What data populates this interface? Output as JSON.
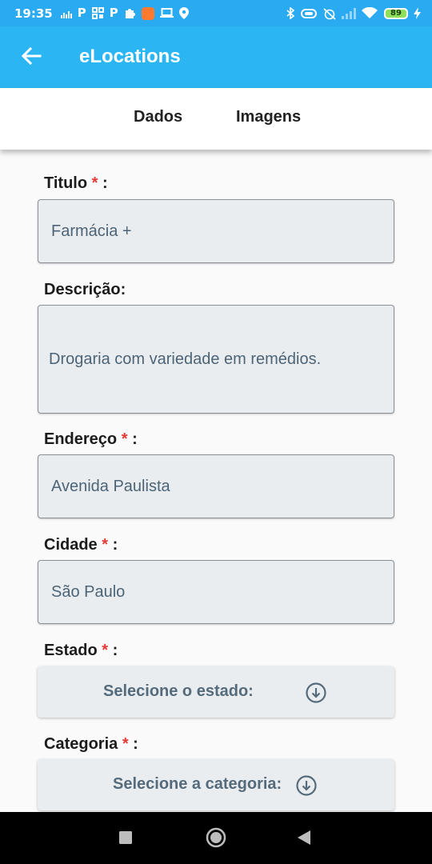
{
  "status_bar": {
    "time": "19:35",
    "battery": "89",
    "left_icons": [
      "equalizer-icon",
      "p-icon",
      "grid-icon",
      "p-icon",
      "puzzle-icon",
      "orange-app-icon",
      "laptop-icon",
      "location-pin-icon"
    ],
    "right_icons": [
      "bluetooth-icon",
      "vibrate-icon",
      "alarm-off-icon",
      "signal-icon",
      "wifi-icon",
      "battery-icon",
      "charging-icon"
    ]
  },
  "app_bar": {
    "title": "eLocations",
    "back_icon": "arrow-left-icon",
    "background": "#2bb5f2"
  },
  "tabs": [
    {
      "label": "Dados"
    },
    {
      "label": "Imagens"
    }
  ],
  "form": {
    "titulo": {
      "label": "Titulo",
      "required_mark": "*",
      "suffix": " :",
      "value": "Farmácia +"
    },
    "descricao": {
      "label": "Descrição:",
      "value": "Drogaria com variedade em remédios."
    },
    "endereco": {
      "label": "Endereço",
      "required_mark": "*",
      "suffix": " :",
      "value": "Avenida Paulista"
    },
    "cidade": {
      "label": "Cidade",
      "required_mark": "*",
      "suffix": " :",
      "value": "São Paulo"
    },
    "estado": {
      "label": "Estado",
      "required_mark": "*",
      "suffix": " :",
      "button_label": "Selecione o estado:",
      "icon": "arrow-down-circle-icon"
    },
    "categoria": {
      "label": "Categoria",
      "required_mark": "*",
      "suffix": " :",
      "button_label": "Selecione a categoria:",
      "icon": "arrow-down-circle-icon"
    }
  },
  "colors": {
    "required": "#e53935",
    "field_bg": "#eaedf0",
    "field_text": "#4c6476"
  },
  "nav_bar": {
    "buttons": [
      "recents-square-icon",
      "home-circle-icon",
      "back-triangle-icon"
    ]
  }
}
